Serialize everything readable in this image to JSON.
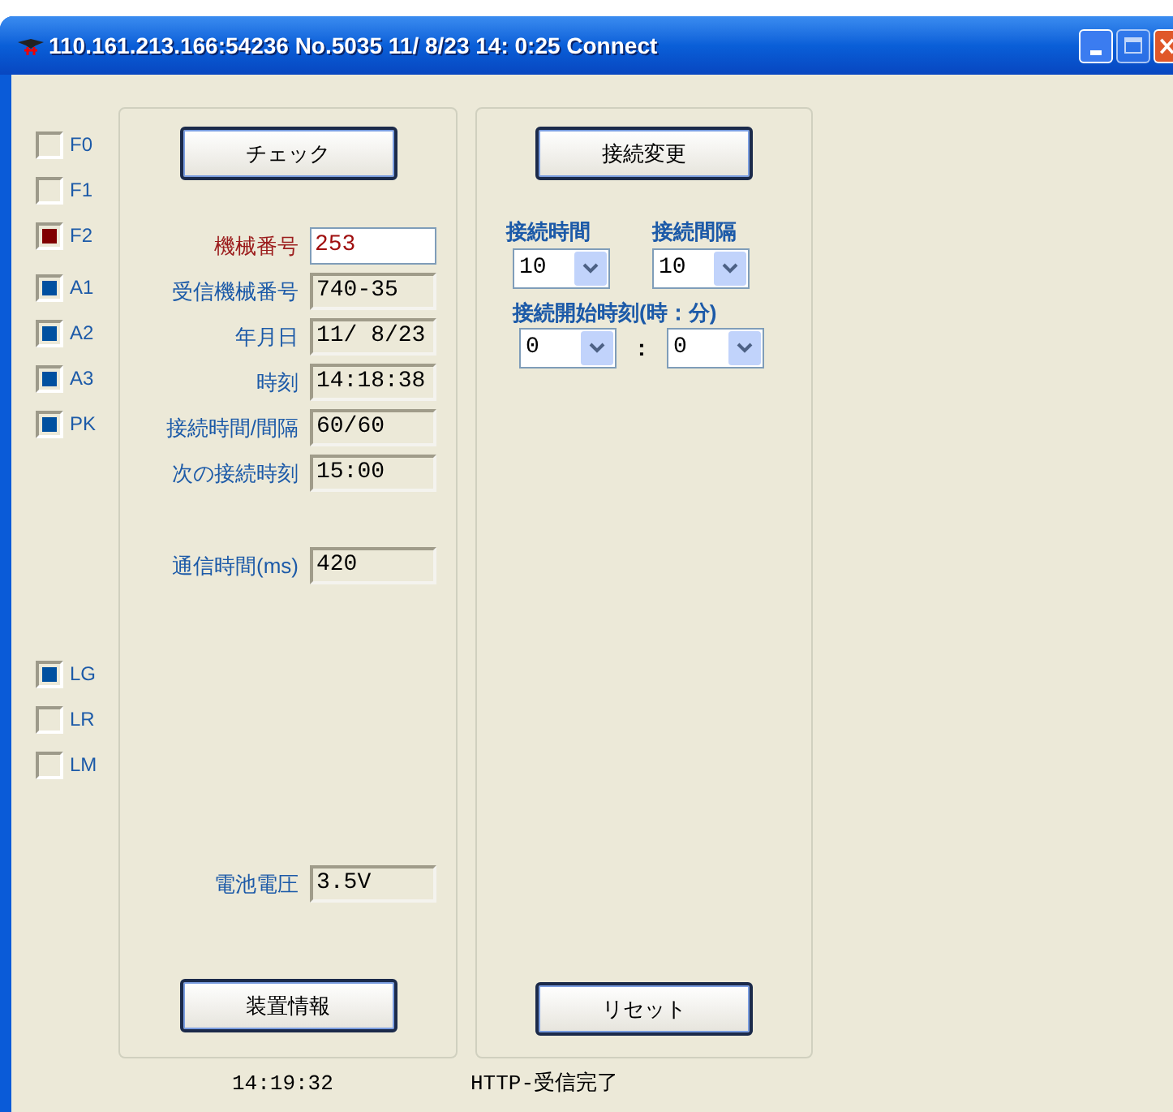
{
  "window": {
    "title": "110.161.213.166:54236 No.5035 11/ 8/23 14: 0:25 Connect"
  },
  "indicator_groups": [
    {
      "items": [
        {
          "label": "F0",
          "on": false
        },
        {
          "label": "F1",
          "on": false
        },
        {
          "label": "F2",
          "on": true,
          "color": "#800000"
        }
      ]
    },
    {
      "items": [
        {
          "label": "A1",
          "on": true,
          "color": "#0050a0"
        },
        {
          "label": "A2",
          "on": true,
          "color": "#0050a0"
        },
        {
          "label": "A3",
          "on": true,
          "color": "#0050a0"
        },
        {
          "label": "PK",
          "on": true,
          "color": "#0050a0"
        }
      ]
    },
    {
      "items": [
        {
          "label": "LG",
          "on": true,
          "color": "#0050a0"
        },
        {
          "label": "LR",
          "on": false
        },
        {
          "label": "LM",
          "on": false
        }
      ]
    }
  ],
  "left_panel": {
    "check_button": "チェック",
    "fields": [
      {
        "label": "機械番号",
        "value": "253",
        "kind": "input"
      },
      {
        "label": "受信機械番号",
        "value": "740-35",
        "kind": "readonly"
      },
      {
        "label": "年月日",
        "value": "11/ 8/23",
        "kind": "readonly"
      },
      {
        "label": "時刻",
        "value": "14:18:38",
        "kind": "readonly"
      },
      {
        "label": "接続時間/間隔",
        "value": "60/60",
        "kind": "readonly"
      },
      {
        "label": "次の接続時刻",
        "value": "15:00",
        "kind": "readonly"
      }
    ],
    "comm_time": {
      "label": "通信時間(ms)",
      "value": "420"
    },
    "battery": {
      "label": "電池電圧",
      "value": "3.5V"
    },
    "info_button": "装置情報"
  },
  "right_panel": {
    "change_button": "接続変更",
    "connect_time": {
      "label": "接続時間",
      "value": "10"
    },
    "connect_interval": {
      "label": "接続間隔",
      "value": "10"
    },
    "start_label": "接続開始時刻(時：分)",
    "start_hour": "0",
    "separator": ":",
    "start_minute": "0",
    "reset_button": "リセット"
  },
  "status_bar": {
    "time": "14:19:32",
    "message": "HTTP-受信完了"
  }
}
